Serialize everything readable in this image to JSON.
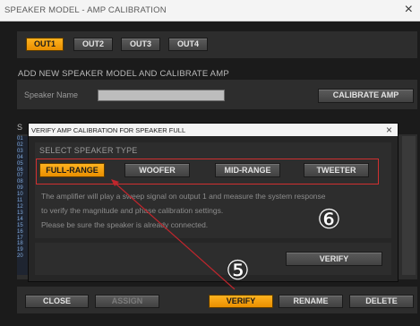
{
  "window": {
    "title": "SPEAKER MODEL - AMP CALIBRATION",
    "close_glyph": "×"
  },
  "outputs": {
    "tabs": [
      "OUT1",
      "OUT2",
      "OUT3",
      "OUT4"
    ],
    "active": "OUT1"
  },
  "add_model": {
    "heading": "ADD NEW SPEAKER MODEL AND CALIBRATE AMP",
    "name_label": "Speaker Name",
    "name_value": "",
    "calibrate_button": "CALIBRATE AMP"
  },
  "list_partial_letter": "S",
  "list_row_numbers": [
    "01",
    "02",
    "03",
    "04",
    "05",
    "06",
    "07",
    "08",
    "09",
    "10",
    "11",
    "12",
    "13",
    "14",
    "15",
    "16",
    "17",
    "18",
    "19",
    "20"
  ],
  "dialog": {
    "title": "VERIFY AMP CALIBRATION FOR SPEAKER FULL",
    "close_glyph": "×",
    "select_heading": "SELECT SPEAKER TYPE",
    "types": [
      "FULL-RANGE",
      "WOOFER",
      "MID-RANGE",
      "TWEETER"
    ],
    "selected_type": "FULL-RANGE",
    "description": [
      "The amplifier will play a sweep signal on output 1 and measure the system response",
      "to verify the magnitude and phase calibration settings.",
      "Please be sure the speaker is already connected."
    ],
    "verify_button": "VERIFY"
  },
  "footer": {
    "close": "CLOSE",
    "assign": "ASSIGN",
    "verify": "VERIFY",
    "rename": "RENAME",
    "delete": "DELETE"
  },
  "annotations": {
    "step5": "⑤",
    "step6": "⑥",
    "arrow_color": "#c0262d"
  },
  "colors": {
    "accent": "#f5a000",
    "highlight": "#d03030"
  }
}
